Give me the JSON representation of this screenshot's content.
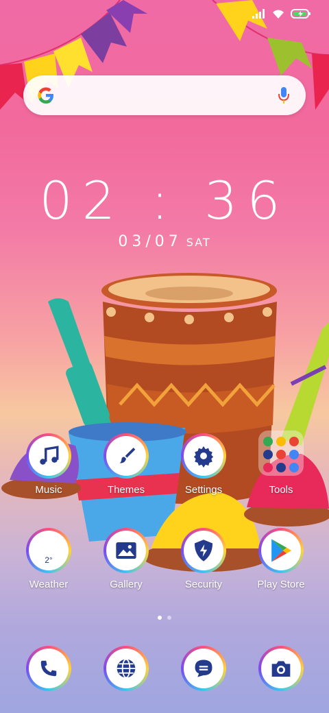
{
  "clock": {
    "time": "02 : 36",
    "date": "03/07",
    "day": "SAT"
  },
  "search": {
    "provider": "Google"
  },
  "apps": [
    {
      "label": "Music",
      "icon": "music-note-icon"
    },
    {
      "label": "Themes",
      "icon": "paintbrush-icon"
    },
    {
      "label": "Settings",
      "icon": "gear-icon"
    },
    {
      "label": "Tools",
      "icon": "folder-icon"
    },
    {
      "label": "Weather",
      "icon": "weather-icon",
      "temp": "2°"
    },
    {
      "label": "Gallery",
      "icon": "gallery-icon"
    },
    {
      "label": "Security",
      "icon": "shield-icon"
    },
    {
      "label": "Play Store",
      "icon": "play-store-icon"
    }
  ],
  "dock": [
    {
      "icon": "phone-icon"
    },
    {
      "icon": "globe-icon"
    },
    {
      "icon": "message-icon"
    },
    {
      "icon": "camera-icon"
    }
  ],
  "page_indicator": {
    "pages": 2,
    "current": 1
  },
  "colors": {
    "accent": "#243a8c",
    "bg_top": "#f06aa6",
    "bg_bottom": "#9fa6e0"
  }
}
